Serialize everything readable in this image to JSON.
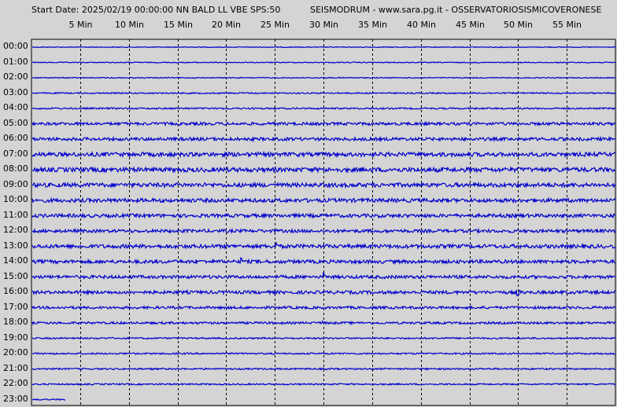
{
  "header": {
    "start_info": "Start Date: 2025/02/19 00:00:00 NN BALD LL VBE SPS:50",
    "source": "SEISMODRUM - www.sara.pg.it - OSSERVATORIOSISMICOVERONESE"
  },
  "colors": {
    "trace": "#0000cc",
    "background": "#d4d4d4",
    "grid": "#000000"
  },
  "chart_data": {
    "type": "line",
    "title": "",
    "xlabel": "",
    "ylabel": "",
    "x_range_minutes": [
      0,
      60
    ],
    "grid": true,
    "x_ticks": [
      "5 Min",
      "10 Min",
      "15 Min",
      "20 Min",
      "25 Min",
      "30 Min",
      "35 Min",
      "40 Min",
      "45 Min",
      "50 Min",
      "55 Min"
    ],
    "rows": [
      "00:00",
      "01:00",
      "02:00",
      "03:00",
      "04:00",
      "05:00",
      "06:00",
      "07:00",
      "08:00",
      "09:00",
      "10:00",
      "11:00",
      "12:00",
      "13:00",
      "14:00",
      "15:00",
      "16:00",
      "17:00",
      "18:00",
      "19:00",
      "20:00",
      "21:00",
      "22:00",
      "23:00"
    ],
    "row_noise_amplitude": [
      0.5,
      0.6,
      0.6,
      0.8,
      1.0,
      1.8,
      2.0,
      2.6,
      2.8,
      2.6,
      2.4,
      2.2,
      2.0,
      2.4,
      2.2,
      2.0,
      2.0,
      1.6,
      1.4,
      1.0,
      1.0,
      1.0,
      0.9,
      0.8
    ],
    "last_row_end_minute": 3.5,
    "events": [
      {
        "row": "13:00",
        "minute": 25.0,
        "amplitude": 16
      },
      {
        "row": "14:00",
        "minute": 21.5,
        "amplitude": 6
      },
      {
        "row": "15:00",
        "minute": 30.0,
        "amplitude": 7
      },
      {
        "row": "16:00",
        "minute": 50.0,
        "amplitude": 7
      },
      {
        "row": "18:00",
        "minute": 30.0,
        "amplitude": 3
      }
    ]
  }
}
